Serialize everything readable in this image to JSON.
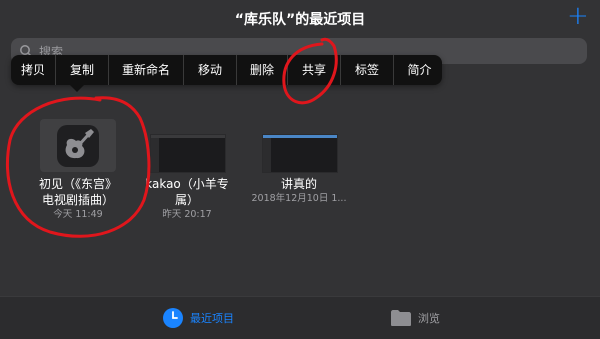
{
  "header": {
    "title": "“库乐队”的最近项目",
    "add_label": "+"
  },
  "search": {
    "placeholder": "搜索"
  },
  "context_menu": {
    "items": [
      "拷贝",
      "复制",
      "重新命名",
      "移动",
      "删除",
      "共享",
      "标签",
      "简介"
    ]
  },
  "files": [
    {
      "name_line1": "初见（《东宫》",
      "name_line2": "电视剧插曲）",
      "date": "今天 11:49"
    },
    {
      "name_line1": "kakao（小羊专",
      "name_line2": "属）",
      "date": "昨天 20:17"
    },
    {
      "name_line1": "讲真的",
      "name_line2": "",
      "date": "2018年12月10日 1..."
    }
  ],
  "tabbar": {
    "recent_label": "最近项目",
    "browse_label": "浏览"
  },
  "colors": {
    "accent": "#1a84ff",
    "annotation": "#e0161c",
    "background": "#333335"
  }
}
